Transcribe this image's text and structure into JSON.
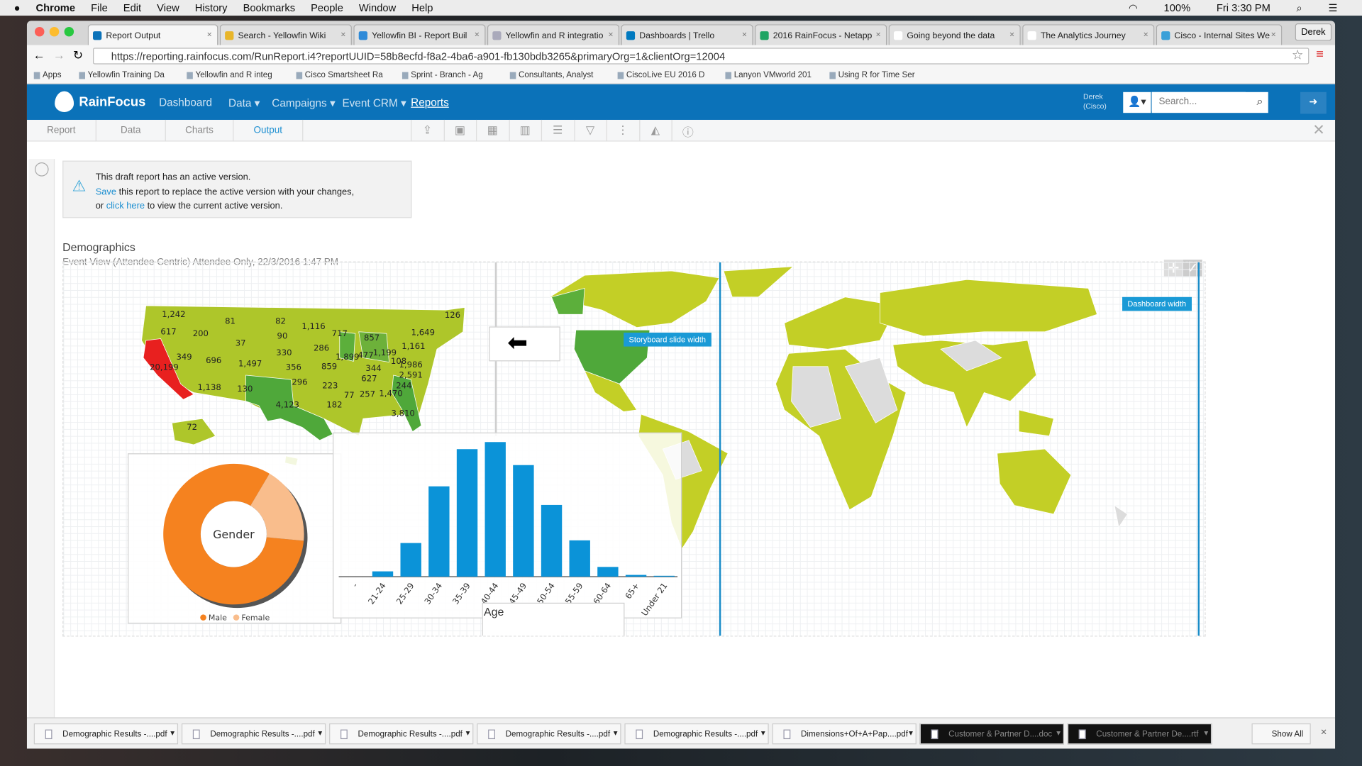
{
  "menubar": {
    "app": "Chrome",
    "items": [
      "File",
      "Edit",
      "View",
      "History",
      "Bookmarks",
      "People",
      "Window",
      "Help"
    ],
    "battery": "100%",
    "clock": "Fri 3:30 PM"
  },
  "browser": {
    "tabs": [
      {
        "title": "Report Output",
        "active": true
      },
      {
        "title": "Search - Yellowfin Wiki"
      },
      {
        "title": "Yellowfin BI - Report Buil"
      },
      {
        "title": "Yellowfin and R integratio"
      },
      {
        "title": "Dashboards | Trello"
      },
      {
        "title": "2016 RainFocus - Netapp"
      },
      {
        "title": "Going beyond the data"
      },
      {
        "title": "The Analytics Journey"
      },
      {
        "title": "Cisco - Internal Sites We"
      }
    ],
    "profile": "Derek",
    "url": "https://reporting.rainfocus.com/RunReport.i4?reportUUID=58b8ecfd-f8a2-4ba6-a901-fb130bdb3265&primaryOrg=1&clientOrg=12004",
    "bookmarks": [
      "Apps",
      "Yellowfin Training Da",
      "Yellowfin and R integ",
      "Cisco Smartsheet Ra",
      "Sprint - Branch - Ag",
      "Consultants, Analyst",
      "CiscoLive EU 2016 D",
      "Lanyon VMworld 201",
      "Using R for Time Ser"
    ]
  },
  "app": {
    "logo": "RainFocus",
    "nav": [
      "Dashboard",
      "Data ▾",
      "Campaigns ▾",
      "Event CRM ▾",
      "Reports"
    ],
    "user": "Derek\n(Cisco)",
    "search_placeholder": "Search...",
    "subtabs": [
      "Report",
      "Data",
      "Charts",
      "Output"
    ],
    "active_subtab": "Output",
    "accent": "#0b72b9"
  },
  "notice": {
    "line1": "This draft report has an active version.",
    "save": "Save",
    "line2": " this report to replace the active version with your changes,",
    "or": "or ",
    "click": "click here",
    "line3": " to view the current active version."
  },
  "report": {
    "title": "Demographics",
    "subtitle": "Event View (Attendee Centric) Attendee Only, 22/3/2016 1:47 PM",
    "storyboard_label": "Storyboard slide width",
    "dashboard_label": "Dashboard width"
  },
  "us_map_values": [
    "1,242",
    "617",
    "200",
    "81",
    "82",
    "1,116",
    "717",
    "857",
    "1,649",
    "126",
    "90",
    "37",
    "349",
    "20,199",
    "696",
    "1,497",
    "330",
    "286",
    "1,899",
    "477",
    "1,199",
    "1,161",
    "108",
    "1,986",
    "356",
    "859",
    "344",
    "2,591",
    "627",
    "296",
    "223",
    "244",
    "1,138",
    "130",
    "4,123",
    "77",
    "257",
    "1,470",
    "182",
    "3,810",
    "72"
  ],
  "chart_data": [
    {
      "type": "pie",
      "title": "Gender",
      "donut": true,
      "categories": [
        "Male",
        "Female"
      ],
      "values": [
        82,
        18
      ],
      "colors": [
        "#f5821f",
        "#f9bd8c"
      ],
      "legend": "bottom"
    },
    {
      "type": "bar",
      "xlabel": "Age",
      "ylabel": "",
      "categories": [
        "-",
        "21-24",
        "25-29",
        "30-34",
        "35-39",
        "40-44",
        "45-49",
        "50-54",
        "55-59",
        "60-64",
        "65+",
        "Under 21"
      ],
      "values": [
        0,
        6,
        38,
        102,
        144,
        152,
        126,
        81,
        41,
        11,
        2,
        1
      ],
      "color": "#0b93d8",
      "grid": false
    }
  ],
  "downloads": [
    "Demographic Results -....pdf",
    "Demographic Results -....pdf",
    "Demographic Results -....pdf",
    "Demographic Results -....pdf",
    "Demographic Results -....pdf",
    "Dimensions+Of+A+Pap....pdf",
    "Customer & Partner D....doc",
    "Customer & Partner De....rtf"
  ],
  "show_all": "Show All"
}
